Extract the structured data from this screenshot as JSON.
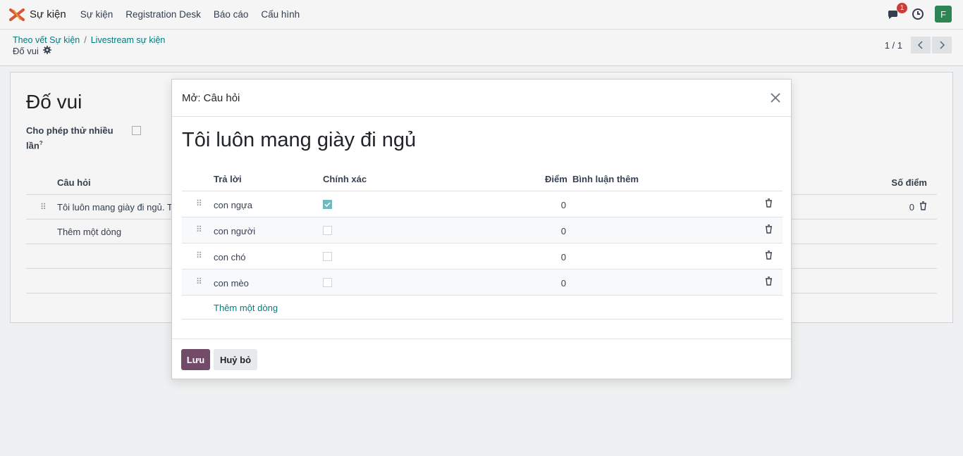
{
  "navbar": {
    "app_name": "Sự kiện",
    "menu": [
      "Sự kiện",
      "Registration Desk",
      "Báo cáo",
      "Cấu hình"
    ],
    "chat_badge": "1",
    "user_initial": "F"
  },
  "breadcrumb": {
    "items": [
      "Theo vết Sự kiện",
      "Livestream sự kiện"
    ],
    "separator": "/",
    "current": "Đố vui"
  },
  "pager": {
    "value": "1 / 1"
  },
  "form": {
    "title": "Đố vui",
    "field_label": "Cho phép thử nhiều lần",
    "field_help": "?",
    "list_headers": {
      "question": "Câu hỏi",
      "points": "Số điểm"
    },
    "rows": [
      {
        "text": "Tôi luôn mang giày đi ngủ. Tô",
        "points": "0"
      }
    ],
    "add_line": "Thêm một dòng"
  },
  "modal": {
    "title": "Mở: Câu hỏi",
    "question": "Tôi luôn mang giày đi ngủ",
    "headers": {
      "answer": "Trả lời",
      "correct": "Chính xác",
      "points": "Điểm",
      "comment": "Bình luận thêm"
    },
    "answers": [
      {
        "text": "con ngựa",
        "correct": true,
        "points": "0"
      },
      {
        "text": "con người",
        "correct": false,
        "points": "0"
      },
      {
        "text": "con chó",
        "correct": false,
        "points": "0"
      },
      {
        "text": "con mèo",
        "correct": false,
        "points": "0"
      }
    ],
    "add_line": "Thêm một dòng",
    "save_label": "Lưu",
    "cancel_label": "Huỷ bỏ"
  },
  "colors": {
    "brand": "#714b67",
    "link": "#017e84",
    "check": "#71b9bc",
    "badge": "#d23f3a",
    "avatar": "#2e8b57"
  }
}
